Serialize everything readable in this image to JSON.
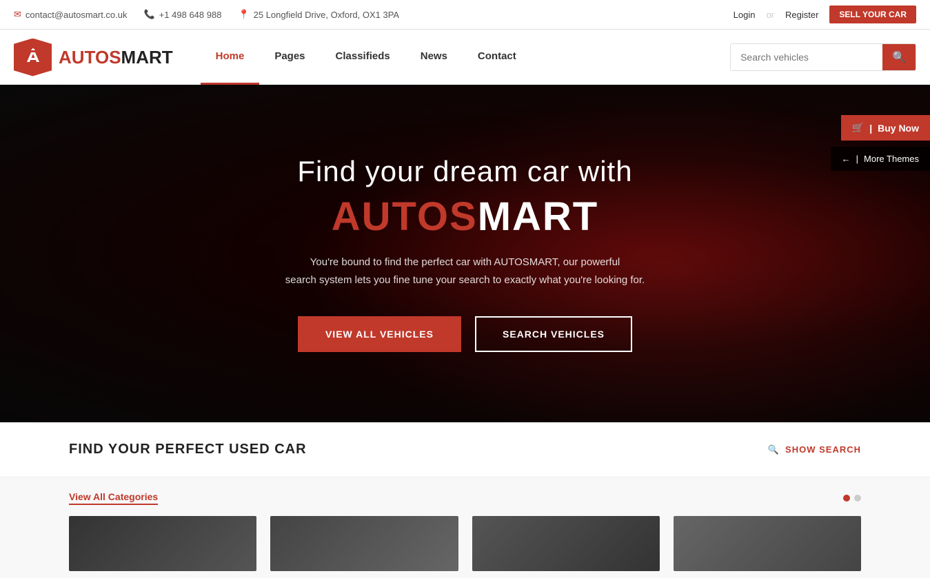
{
  "topbar": {
    "email": "contact@autosmart.co.uk",
    "phone": "+1 498 648 988",
    "address": "25 Longfield Drive, Oxford, OX1 3PA",
    "login_label": "Login",
    "or_label": "or",
    "register_label": "Register",
    "sell_car_label": "Sell Your Car"
  },
  "navbar": {
    "brand_auto": "AUTOS",
    "brand_mart": "MART",
    "logo_letter": "A",
    "nav_items": [
      {
        "label": "Home",
        "active": true
      },
      {
        "label": "Pages",
        "active": false
      },
      {
        "label": "Classifieds",
        "active": false
      },
      {
        "label": "News",
        "active": false
      },
      {
        "label": "Contact",
        "active": false
      }
    ],
    "search_placeholder": "Search vehicles"
  },
  "hero": {
    "title": "Find your dream car with",
    "brand_auto": "AUTOS",
    "brand_mart": "MART",
    "subtitle_line1": "You're bound to find the perfect car with AUTOSMART, our powerful",
    "subtitle_line2": "search system lets you fine tune your search to exactly what you're looking for.",
    "btn_view_all": "VIEW ALL VEHICLES",
    "btn_search": "SEARCH VEHICLES"
  },
  "widgets": {
    "buy_now_icon": "🛒",
    "buy_now_label": "Buy Now",
    "arrow_icon": "←",
    "separator": "|",
    "more_themes_label": "More Themes"
  },
  "search_section": {
    "title": "FIND YOUR PERFECT USED CAR",
    "search_icon": "🔍",
    "show_search_label": "SHOW SEARCH"
  },
  "categories_section": {
    "view_all_label": "View All Categories"
  },
  "colors": {
    "primary": "#c0392b",
    "dark": "#222222",
    "text": "#555555"
  }
}
